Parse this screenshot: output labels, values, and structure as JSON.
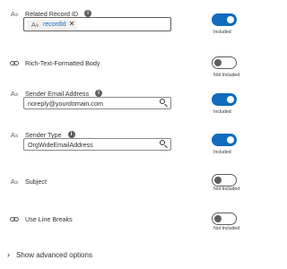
{
  "fields": [
    {
      "label": "Related Record ID",
      "type_icon": "text-type-icon",
      "has_info": true,
      "token": "recordId",
      "toggle_on": true,
      "status": "Included"
    },
    {
      "label": "Rich-Text-Formatted Body",
      "type_icon": "link-type-icon",
      "has_info": false,
      "toggle_on": false,
      "status": "Not Included"
    },
    {
      "label": "Sender Email Address",
      "type_icon": "text-type-icon",
      "has_info": true,
      "value": "noreply@yourdomain.com",
      "toggle_on": true,
      "status": "Included"
    },
    {
      "label": "Sender Type",
      "type_icon": "text-type-icon",
      "has_info": true,
      "value": "OrgWideEmailAddress",
      "toggle_on": true,
      "status": "Included"
    },
    {
      "label": "Subject",
      "type_icon": "text-type-icon",
      "has_info": false,
      "toggle_on": false,
      "status": "Not Included"
    },
    {
      "label": "Use Line Breaks",
      "type_icon": "link-type-icon",
      "has_info": false,
      "toggle_on": false,
      "status": "Not Included"
    }
  ],
  "type_icon_text": {
    "main": "A",
    "sub": "b"
  },
  "info_glyph": "i",
  "token_remove_glyph": "✕",
  "advanced": {
    "label": "Show advanced options",
    "chevron": "›"
  },
  "colors": {
    "accent": "#0f6cbd",
    "toggle_off": "#605e5c",
    "border": "#8a8886"
  }
}
